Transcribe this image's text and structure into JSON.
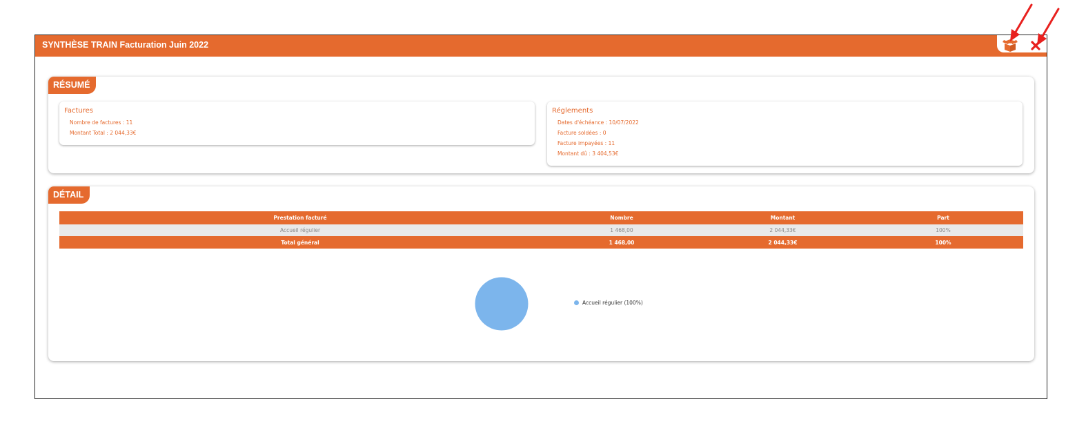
{
  "window": {
    "title": "SYNTHÈSE TRAIN Facturation Juin 2022",
    "actions": [
      {
        "name": "export",
        "icon": "open-box-icon"
      },
      {
        "name": "close",
        "icon": "close-x-icon"
      }
    ]
  },
  "resume": {
    "tag": "RÉSUMÉ",
    "factures": {
      "title": "Factures",
      "lines": [
        "Nombre de factures : 11",
        "Montant Total : 2 044,33€"
      ]
    },
    "reglements": {
      "title": "Réglements",
      "lines": [
        "Dates d'échéance : 10/07/2022",
        "Facture soldées : 0",
        "Facture impayées : 11",
        "Montant dû : 3 404,53€"
      ]
    }
  },
  "detail": {
    "tag": "DÉTAIL",
    "table": {
      "headers": [
        "Prestation facturé",
        "Nombre",
        "Montant",
        "Part"
      ],
      "rows": [
        [
          "Accueil régulier",
          "1 468,00",
          "2 044,33€",
          "100%"
        ]
      ],
      "total": [
        "Total général",
        "1 468,00",
        "2 044,33€",
        "100%"
      ]
    },
    "legend": "Accueil régulier (100%)"
  },
  "chart_data": {
    "type": "pie",
    "categories": [
      "Accueil régulier"
    ],
    "values": [
      100
    ],
    "colors": [
      "#7cb5ec"
    ]
  },
  "colors": {
    "accent": "#e56a2e",
    "row_bg": "#e9e9e9",
    "pie": "#7cb5ec",
    "annotation_arrow": "#e8201e"
  }
}
